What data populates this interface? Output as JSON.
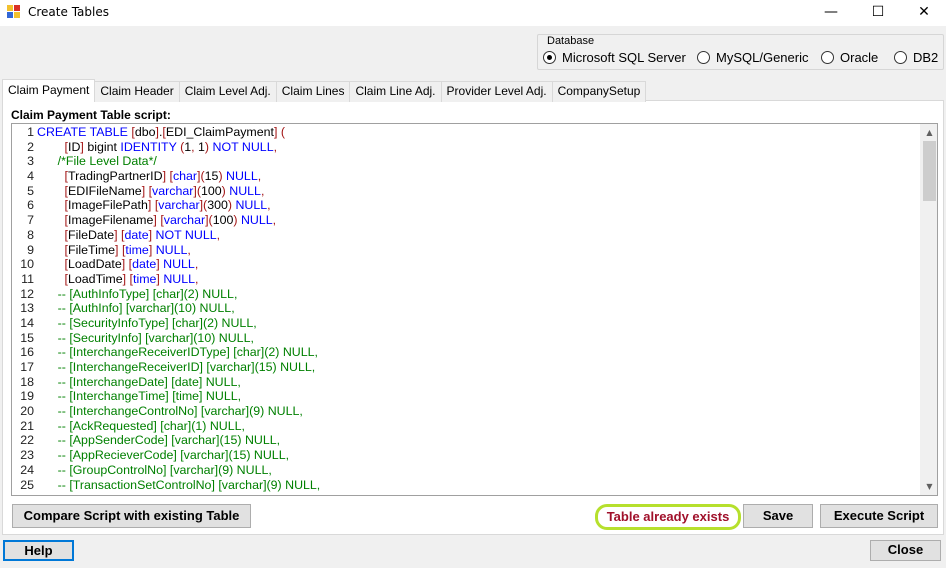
{
  "window": {
    "title": "Create Tables",
    "minimize_glyph": "—",
    "maximize_glyph": "☐",
    "close_glyph": "✕"
  },
  "database": {
    "legend": "Database",
    "options": [
      {
        "label": "Microsoft SQL Server",
        "selected": true
      },
      {
        "label": "MySQL/Generic",
        "selected": false
      },
      {
        "label": "Oracle",
        "selected": false
      },
      {
        "label": "DB2",
        "selected": false
      }
    ]
  },
  "tabs": [
    "Claim Payment",
    "Claim Header",
    "Claim Level Adj.",
    "Claim Lines",
    "Claim Line Adj.",
    "Provider Level Adj.",
    "CompanySetup"
  ],
  "active_tab": "Claim Payment",
  "script_label": "Claim Payment Table script:",
  "code_lines": [
    "CREATE TABLE [dbo].[EDI_ClaimPayment] (",
    "        [ID] bigint IDENTITY (1, 1) NOT NULL,",
    "      /*File Level Data*/",
    "        [TradingPartnerID] [char](15) NULL,",
    "        [EDIFileName] [varchar](100) NULL,",
    "        [ImageFilePath] [varchar](300) NULL,",
    "        [ImageFilename] [varchar](100) NULL,",
    "        [FileDate] [date] NOT NULL,",
    "        [FileTime] [time] NULL,",
    "        [LoadDate] [date] NULL,",
    "        [LoadTime] [time] NULL,",
    "      -- [AuthInfoType] [char](2) NULL,",
    "      -- [AuthInfo] [varchar](10) NULL,",
    "      -- [SecurityInfoType] [char](2) NULL,",
    "      -- [SecurityInfo] [varchar](10) NULL,",
    "      -- [InterchangeReceiverIDType] [char](2) NULL,",
    "      -- [InterchangeReceiverID] [varchar](15) NULL,",
    "      -- [InterchangeDate] [date] NULL,",
    "      -- [InterchangeTime] [time] NULL,",
    "      -- [InterchangeControlNo] [varchar](9) NULL,",
    "      -- [AckRequested] [char](1) NULL,",
    "      -- [AppSenderCode] [varchar](15) NULL,",
    "      -- [AppRecieverCode] [varchar](15) NULL,",
    "      -- [GroupControlNo] [varchar](9) NULL,",
    "      -- [TransactionSetControlNo] [varchar](9) NULL,"
  ],
  "buttons": {
    "compare": "Compare Script with existing Table",
    "save": "Save",
    "execute": "Execute Script",
    "help": "Help",
    "close": "Close"
  },
  "status_text": "Table already exists",
  "colors": {
    "keyword": "#0000ff",
    "string_red": "#a31515",
    "comment": "#008000",
    "status_text": "#a0102a",
    "status_highlight": "#b6e02d"
  }
}
